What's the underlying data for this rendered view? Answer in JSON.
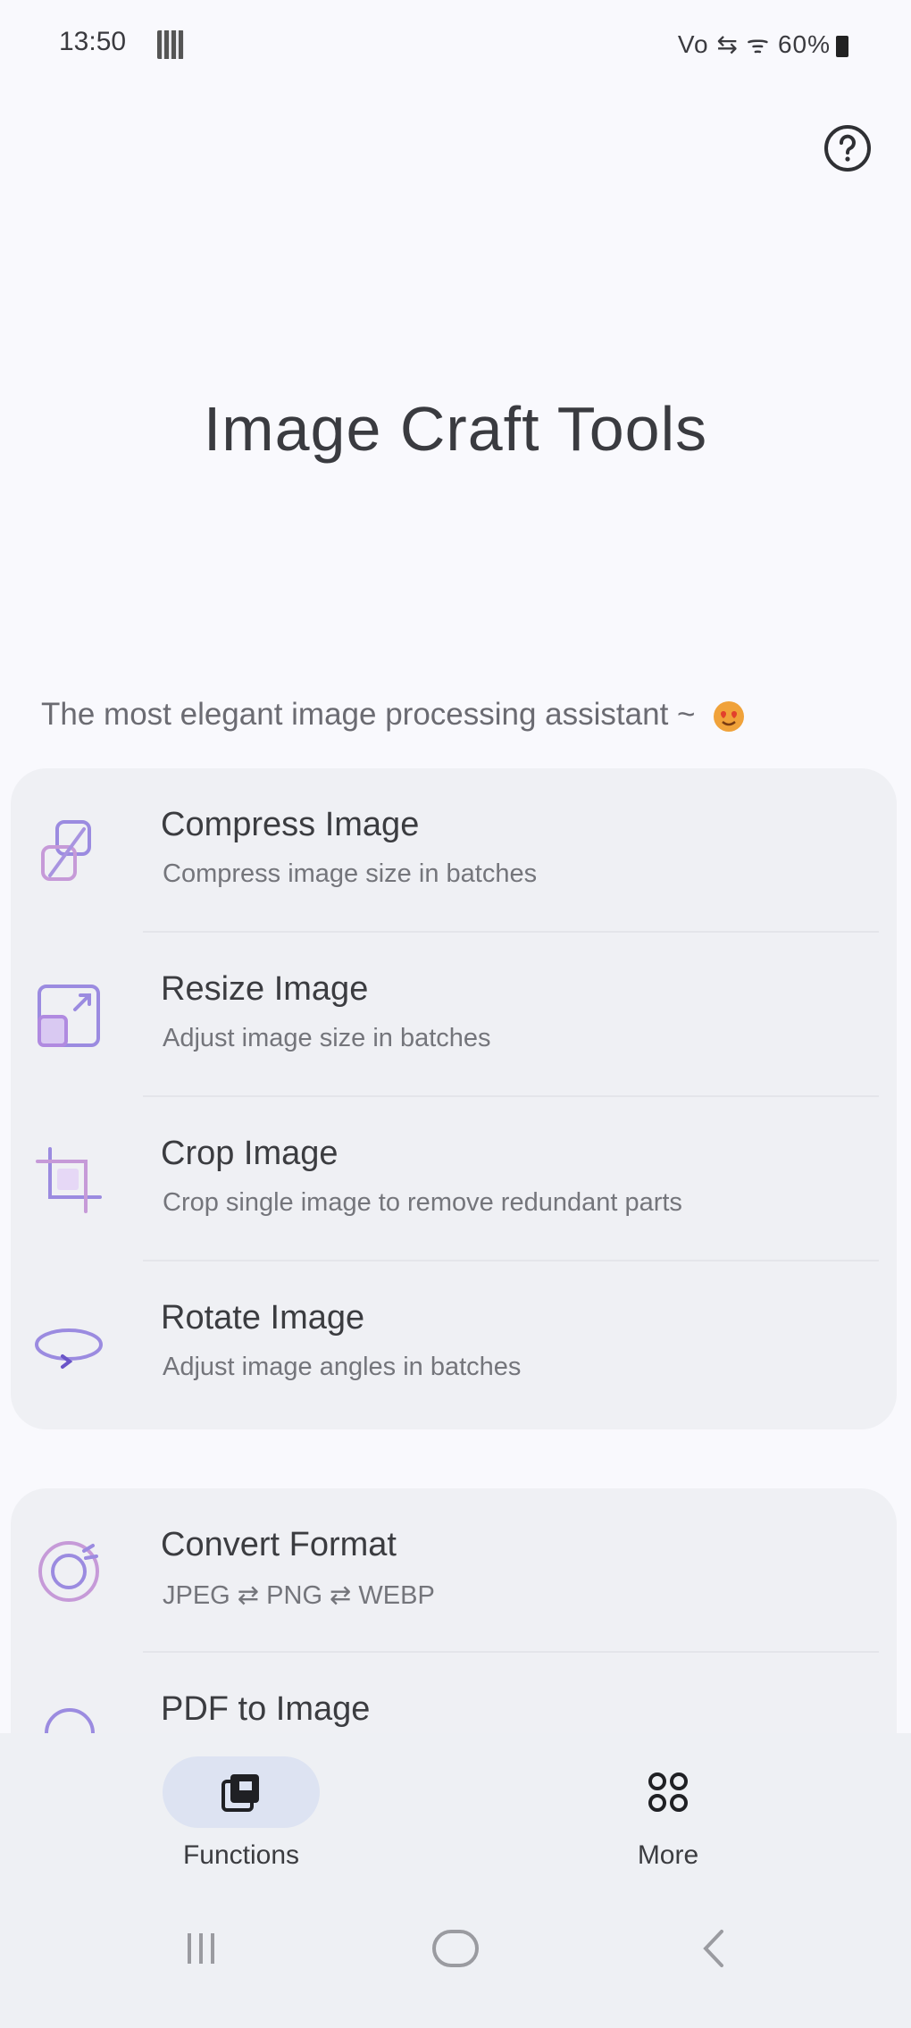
{
  "status_bar": {
    "time": "13:50",
    "right": "Vo ⇆ ᯤ 60%"
  },
  "header": {
    "help_icon": "question-circle-icon",
    "title": "Image Craft Tools",
    "tagline": "The most elegant image processing assistant ~",
    "tagline_emoji": "heart-face-emoji"
  },
  "tools_group_1": [
    {
      "title": "Compress Image",
      "subtitle": "Compress image size in batches",
      "icon": "compress-icon"
    },
    {
      "title": "Resize Image",
      "subtitle": "Adjust image size in batches",
      "icon": "resize-icon"
    },
    {
      "title": "Crop Image",
      "subtitle": "Crop single image to remove redundant parts",
      "icon": "crop-icon"
    },
    {
      "title": "Rotate Image",
      "subtitle": "Adjust image angles in batches",
      "icon": "rotate-icon"
    }
  ],
  "tools_group_2": [
    {
      "title": "Convert Format",
      "subtitle": "JPEG ⇄ PNG ⇄ WEBP",
      "icon": "convert-icon"
    },
    {
      "title": "PDF to Image",
      "subtitle": "",
      "icon": "pdf-icon"
    }
  ],
  "bottom_nav": {
    "functions_label": "Functions",
    "more_label": "More",
    "selected": "Functions"
  },
  "colors": {
    "accent": "#8b6fd6",
    "card_bg": "#eff0f4",
    "nav_pill": "#dde3f2"
  }
}
